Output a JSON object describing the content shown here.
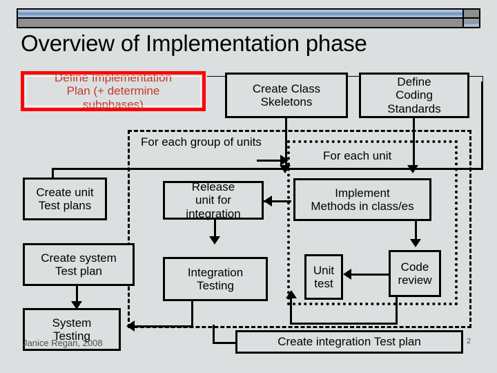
{
  "slide": {
    "title": "Overview of Implementation phase",
    "page_number": "2",
    "credit": "Janice Regan, 2008",
    "background_color": "#dcdfe0",
    "accent_color": "#ff0000",
    "bar_color": "#6d92bd"
  },
  "frames": [
    {
      "name": "for-each-group-of-units",
      "label": "For each group of units",
      "style": "dashed"
    },
    {
      "name": "for-each-unit",
      "label": "For each unit",
      "style": "dotted"
    }
  ],
  "boxes": {
    "define_implementation_plan": "Define Implementation Plan (+ determine subphases)",
    "create_class_skeletons": "Create Class Skeletons",
    "define_coding_standards": "Define Coding Standards",
    "create_unit_test_plans": "Create unit Test plans",
    "create_system_test_plan": "Create system Test plan",
    "system_testing": "System Testing",
    "release_unit_for_integration": "Release unit for integration",
    "integration_testing": "Integration Testing",
    "implement_methods": "Implement Methods in class/es",
    "unit_test": "Unit test",
    "code_review": "Code review",
    "create_integration_test_plan": "Create integration Test plan"
  },
  "box_lines": {
    "define_implementation_plan": [
      "Define Implementation",
      "Plan (+ determine",
      "subphases)"
    ],
    "create_class_skeletons": [
      "Create Class",
      "Skeletons"
    ],
    "define_coding_standards": [
      "Define",
      "Coding",
      "Standards"
    ],
    "create_unit_test_plans": [
      "Create unit",
      "Test plans"
    ],
    "create_system_test_plan": [
      "Create system",
      "Test plan"
    ],
    "system_testing": [
      "System",
      "Testing"
    ],
    "release_unit_for_integration": [
      "Release",
      "unit for",
      "integration"
    ],
    "integration_testing": [
      "Integration",
      "Testing"
    ],
    "implement_methods": [
      "Implement",
      "Methods in class/es"
    ],
    "unit_test": [
      "Unit",
      "test"
    ],
    "code_review": [
      "Code",
      "review"
    ],
    "create_integration_test_plan": [
      "Create integration Test plan"
    ]
  }
}
